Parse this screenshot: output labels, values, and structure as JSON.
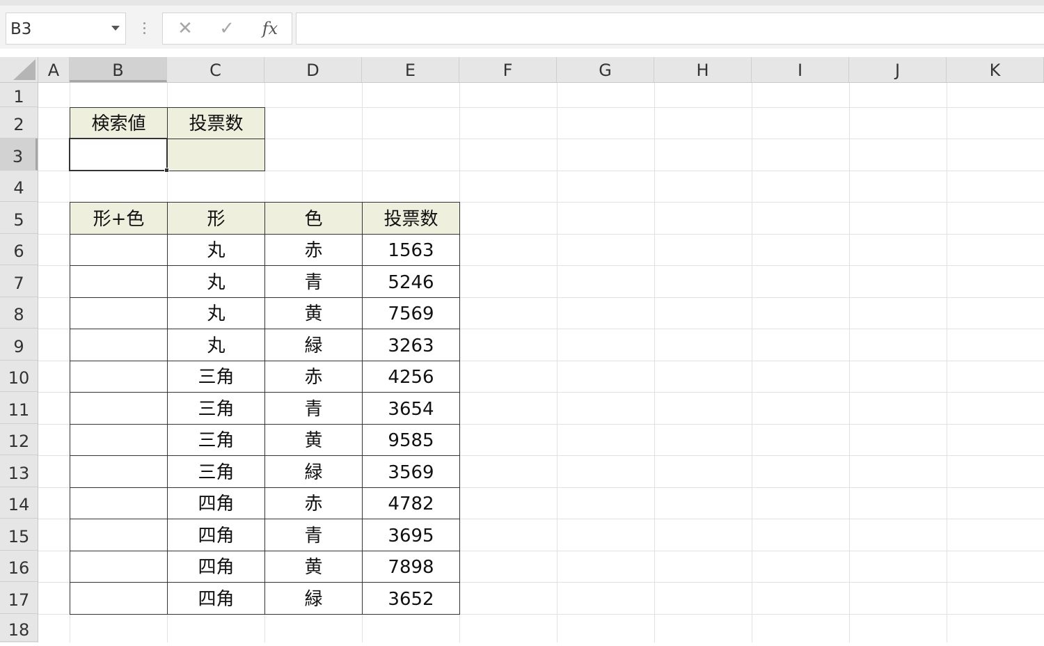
{
  "formula_bar": {
    "name_box": "B3",
    "cancel_icon": "✕",
    "enter_icon": "✓",
    "fx_label": "fx",
    "formula": ""
  },
  "columns": [
    "A",
    "B",
    "C",
    "D",
    "E",
    "F",
    "G",
    "H",
    "I",
    "J",
    "K"
  ],
  "rows": [
    "1",
    "2",
    "3",
    "4",
    "5",
    "6",
    "7",
    "8",
    "9",
    "10",
    "11",
    "12",
    "13",
    "14",
    "15",
    "16",
    "17",
    "18"
  ],
  "selected_cell": "B3",
  "lookup_table": {
    "headers": [
      "検索値",
      "投票数"
    ],
    "values": [
      "",
      ""
    ]
  },
  "data_table": {
    "headers": [
      "形+色",
      "形",
      "色",
      "投票数"
    ],
    "rows": [
      [
        "",
        "丸",
        "赤",
        "1563"
      ],
      [
        "",
        "丸",
        "青",
        "5246"
      ],
      [
        "",
        "丸",
        "黄",
        "7569"
      ],
      [
        "",
        "丸",
        "緑",
        "3263"
      ],
      [
        "",
        "三角",
        "赤",
        "4256"
      ],
      [
        "",
        "三角",
        "青",
        "3654"
      ],
      [
        "",
        "三角",
        "黄",
        "9585"
      ],
      [
        "",
        "三角",
        "緑",
        "3569"
      ],
      [
        "",
        "四角",
        "赤",
        "4782"
      ],
      [
        "",
        "四角",
        "青",
        "3695"
      ],
      [
        "",
        "四角",
        "黄",
        "7898"
      ],
      [
        "",
        "四角",
        "緑",
        "3652"
      ]
    ]
  },
  "colors": {
    "header_fill": "#eeefdc",
    "gridline": "#e1e1e1",
    "heading_bg": "#e6e6e6"
  }
}
